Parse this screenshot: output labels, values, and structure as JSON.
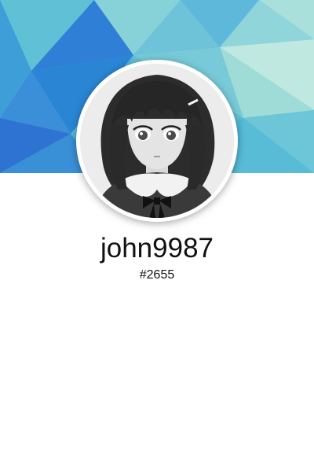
{
  "profile": {
    "username": "john9987",
    "tag": "#2655"
  },
  "cover": {
    "colors": {
      "base": "#4fb5d6",
      "deep_blue": "#2f7fd6",
      "teal": "#6fcad8",
      "light_teal": "#a9e0dc",
      "mint": "#bfe8e0"
    }
  },
  "avatar": {
    "icon": "anime-girl-avatar",
    "ring_color": "#ffffff"
  }
}
